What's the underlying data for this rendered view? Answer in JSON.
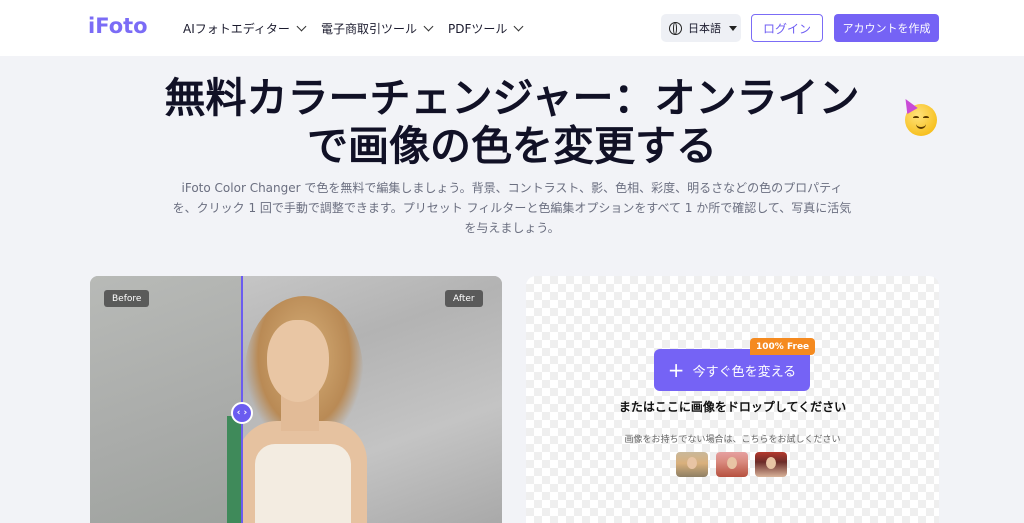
{
  "header": {
    "logo": "iFoto",
    "nav": [
      {
        "label": "AIフォトエディター"
      },
      {
        "label": "電子商取引ツール"
      },
      {
        "label": "PDFツール"
      }
    ],
    "language": "日本語",
    "login": "ログイン",
    "signup": "アカウントを作成"
  },
  "hero": {
    "title_line1": "無料カラーチェンジャー：オンライン",
    "title_line2": "で画像の色を変更する",
    "subtitle_line1": "iFoto Color Changer で色を無料で編集しましょう。背景、コントラスト、影、色相、彩度、明るさなどの色のプロパティ",
    "subtitle_line2": "を、クリック 1 回で手動で調整できます。プリセット フィルターと色編集オプションをすべて 1 か所で確認して、写真に活気",
    "subtitle_line3": "を与えましょう。"
  },
  "compare": {
    "before_label": "Before",
    "after_label": "After",
    "handle_glyph": "‹ ›"
  },
  "upload": {
    "badge": "100% Free",
    "cta_label": "今すぐ色を変える",
    "drop_text": "またはここに画像をドロップしてください",
    "try_text": "画像をお持ちでない場合は、こちらをお試しください",
    "samples": [
      "sample-1",
      "sample-2",
      "sample-3"
    ]
  },
  "colors": {
    "brand": "#7563f5",
    "badge": "#f58a1f"
  }
}
